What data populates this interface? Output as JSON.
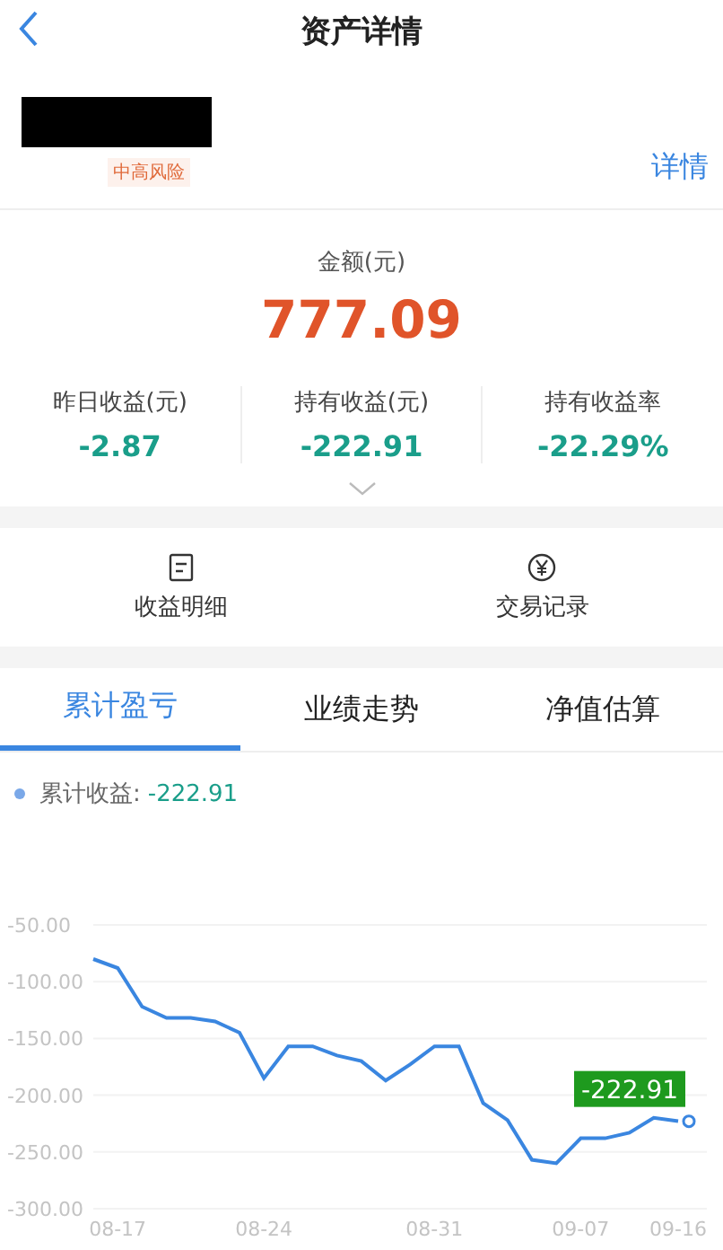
{
  "header": {
    "title": "资产详情"
  },
  "product": {
    "risk_tag": "中高风险",
    "detail_link": "详情"
  },
  "amount": {
    "label": "金额(元)",
    "value": "777.09"
  },
  "stats": [
    {
      "label": "昨日收益(元)",
      "value": "-2.87"
    },
    {
      "label": "持有收益(元)",
      "value": "-222.91"
    },
    {
      "label": "持有收益率",
      "value": "-22.29%"
    }
  ],
  "actions": [
    {
      "kind": "list",
      "label": "收益明细"
    },
    {
      "kind": "yen",
      "label": "交易记录"
    }
  ],
  "tabs": [
    {
      "label": "累计盈亏",
      "selected": true
    },
    {
      "label": "业绩走势",
      "selected": false
    },
    {
      "label": "净值估算",
      "selected": false
    }
  ],
  "legend": {
    "label": "累计收益:",
    "value": "-222.91"
  },
  "chart_data": {
    "type": "line",
    "categories": [
      null,
      "08-17",
      null,
      null,
      null,
      null,
      null,
      "08-24",
      null,
      null,
      null,
      null,
      null,
      null,
      "08-31",
      null,
      null,
      null,
      null,
      null,
      "09-07",
      null,
      null,
      null,
      "09-16"
    ],
    "series": [
      {
        "color": "#3a86e0",
        "values": [
          -80,
          -88,
          -122,
          -132,
          -132,
          -135,
          -145,
          -185,
          -157,
          -157,
          -165,
          -170,
          -187,
          -173,
          -157,
          -157,
          -207,
          -222,
          -257,
          -260,
          -238,
          -238,
          -233,
          -220,
          -223
        ]
      }
    ],
    "ylim": [
      -300,
      -50
    ],
    "yticks": [
      {
        "value": -50,
        "label": "-50.00"
      },
      {
        "value": -100,
        "label": "-100.00"
      },
      {
        "value": -150,
        "label": "-150.00"
      },
      {
        "value": -200,
        "label": "-200.00"
      },
      {
        "value": -250,
        "label": "-250.00"
      },
      {
        "value": -300,
        "label": "-300.00"
      }
    ],
    "grid": true,
    "annotations": [
      {
        "x": "09-16",
        "y": -223,
        "text": "-222.91"
      }
    ]
  }
}
